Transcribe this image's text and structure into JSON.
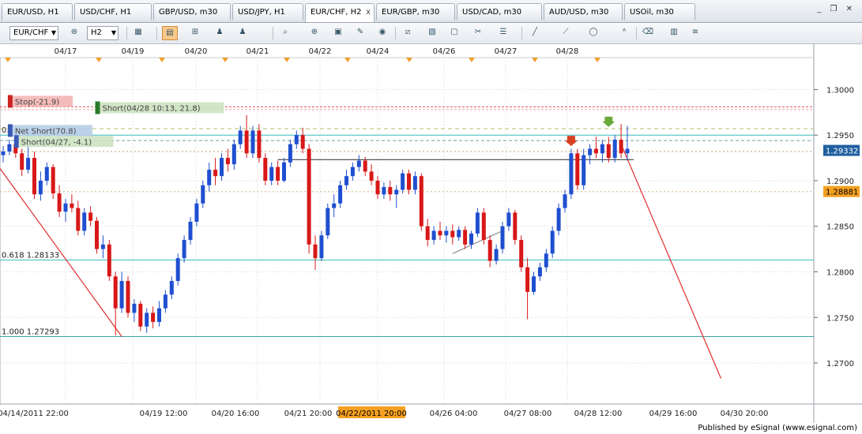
{
  "tabs": [
    {
      "label": "EUR/USD, H1"
    },
    {
      "label": "USD/CHF, H1"
    },
    {
      "label": "GBP/USD, m30"
    },
    {
      "label": "USD/JPY, H1"
    },
    {
      "label": "EUR/CHF, H2",
      "active": true,
      "close": "x"
    },
    {
      "label": "EUR/GBP, m30"
    },
    {
      "label": "USD/CAD, m30"
    },
    {
      "label": "AUD/USD, m30"
    },
    {
      "label": "USOil, m30"
    }
  ],
  "window_controls": "_ ❐ ✕",
  "toolbar": {
    "symbol": "EUR/CHF",
    "interval": "H2",
    "buttons": [
      {
        "icon": "binoculars-icon"
      },
      {
        "icon": "chart-type-icon"
      },
      {
        "icon": "bar-chart-icon",
        "active": true
      },
      {
        "icon": "tick-chart-icon"
      },
      {
        "icon": "people-icon"
      },
      {
        "icon": "people-icon"
      },
      {
        "icon": "zoom-icon"
      },
      {
        "icon": "zoom-in-icon"
      },
      {
        "icon": "chart-book-icon"
      },
      {
        "icon": "study-icon"
      },
      {
        "icon": "globe-icon"
      },
      {
        "icon": "ruler-icon"
      },
      {
        "icon": "image-icon"
      },
      {
        "icon": "window-icon"
      },
      {
        "icon": "tool-icon"
      },
      {
        "icon": "layout-icon"
      },
      {
        "icon": "pen-icon"
      },
      {
        "icon": "trendline-icon"
      },
      {
        "icon": "ellipse-icon"
      },
      {
        "icon": "text-icon"
      },
      {
        "icon": "eraser-icon"
      },
      {
        "icon": "bars-icon"
      },
      {
        "icon": "more-icon"
      }
    ]
  },
  "chart_data": {
    "type": "candlestick",
    "symbol": "EUR/CHF",
    "interval": "H2",
    "ylim": [
      1.2655,
      1.3035
    ],
    "yticks": [
      1.27,
      1.275,
      1.28,
      1.285,
      1.29,
      1.295,
      1.3
    ],
    "ytick_labels": [
      "1.2700",
      "1.2750",
      "1.2800",
      "1.2850",
      "1.2900",
      "1.2950",
      "1.3000"
    ],
    "top_dates": [
      "04/17",
      "04/19",
      "04/20",
      "04/21",
      "04/22",
      "04/24",
      "04/26",
      "04/27",
      "04/28"
    ],
    "bottom_dates": [
      "04/14/2011 22:00",
      "04/19 12:00",
      "04/20 16:00",
      "04/21 20:00",
      "04/22/2011 20:00",
      "04/26 04:00",
      "04/27 08:00",
      "04/28 12:00",
      "04/29 16:00",
      "04/30 20:00"
    ],
    "highlight_date": "04/22/2011 20:00",
    "last_price": "1.29332",
    "last_price_value": 1.29332,
    "other_price": "1.28881",
    "other_price_value": 1.28881,
    "candles": [
      [
        1.2928,
        1.2938,
        1.292,
        1.2932
      ],
      [
        1.2932,
        1.2945,
        1.2928,
        1.294
      ],
      [
        1.294,
        1.295,
        1.2925,
        1.293
      ],
      [
        1.293,
        1.2935,
        1.2905,
        1.2912
      ],
      [
        1.2912,
        1.294,
        1.2908,
        1.2925
      ],
      [
        1.2925,
        1.2932,
        1.288,
        1.2885
      ],
      [
        1.2885,
        1.291,
        1.2878,
        1.29
      ],
      [
        1.29,
        1.292,
        1.2895,
        1.2915
      ],
      [
        1.2915,
        1.2918,
        1.288,
        1.2886
      ],
      [
        1.2886,
        1.2895,
        1.286,
        1.2866
      ],
      [
        1.2866,
        1.288,
        1.2855,
        1.2875
      ],
      [
        1.2875,
        1.2885,
        1.2865,
        1.287
      ],
      [
        1.287,
        1.2878,
        1.284,
        1.2845
      ],
      [
        1.2845,
        1.287,
        1.284,
        1.2865
      ],
      [
        1.2865,
        1.2872,
        1.285,
        1.2856
      ],
      [
        1.2856,
        1.286,
        1.282,
        1.2825
      ],
      [
        1.2825,
        1.284,
        1.2815,
        1.283
      ],
      [
        1.283,
        1.2835,
        1.279,
        1.2795
      ],
      [
        1.2795,
        1.28,
        1.273,
        1.276
      ],
      [
        1.276,
        1.28,
        1.2755,
        1.279
      ],
      [
        1.279,
        1.2795,
        1.275,
        1.2755
      ],
      [
        1.2755,
        1.277,
        1.2745,
        1.2765
      ],
      [
        1.2765,
        1.2768,
        1.2735,
        1.274
      ],
      [
        1.274,
        1.276,
        1.2733,
        1.2755
      ],
      [
        1.2755,
        1.2762,
        1.2738,
        1.2745
      ],
      [
        1.2745,
        1.2768,
        1.274,
        1.276
      ],
      [
        1.276,
        1.278,
        1.2755,
        1.2775
      ],
      [
        1.2775,
        1.2795,
        1.277,
        1.279
      ],
      [
        1.279,
        1.282,
        1.2785,
        1.2815
      ],
      [
        1.2815,
        1.284,
        1.281,
        1.2835
      ],
      [
        1.2835,
        1.286,
        1.283,
        1.2855
      ],
      [
        1.2855,
        1.288,
        1.285,
        1.2875
      ],
      [
        1.2875,
        1.29,
        1.287,
        1.2895
      ],
      [
        1.2895,
        1.292,
        1.2888,
        1.2912
      ],
      [
        1.2912,
        1.2925,
        1.2895,
        1.2905
      ],
      [
        1.2905,
        1.293,
        1.29,
        1.2925
      ],
      [
        1.2925,
        1.2935,
        1.291,
        1.2918
      ],
      [
        1.2918,
        1.2945,
        1.2912,
        1.294
      ],
      [
        1.294,
        1.296,
        1.2935,
        1.2955
      ],
      [
        1.2955,
        1.2972,
        1.2925,
        1.293
      ],
      [
        1.293,
        1.296,
        1.2925,
        1.2955
      ],
      [
        1.2955,
        1.2962,
        1.292,
        1.2925
      ],
      [
        1.2925,
        1.293,
        1.2895,
        1.29
      ],
      [
        1.29,
        1.292,
        1.2895,
        1.2915
      ],
      [
        1.2915,
        1.2922,
        1.2895,
        1.29
      ],
      [
        1.29,
        1.2925,
        1.2898,
        1.292
      ],
      [
        1.292,
        1.2945,
        1.2915,
        1.294
      ],
      [
        1.294,
        1.2955,
        1.2935,
        1.295
      ],
      [
        1.295,
        1.2958,
        1.293,
        1.2935
      ],
      [
        1.2935,
        1.294,
        1.282,
        1.283
      ],
      [
        1.283,
        1.284,
        1.2802,
        1.2815
      ],
      [
        1.2815,
        1.2845,
        1.2812,
        1.284
      ],
      [
        1.284,
        1.2875,
        1.2836,
        1.287
      ],
      [
        1.287,
        1.2885,
        1.286,
        1.2875
      ],
      [
        1.2875,
        1.29,
        1.287,
        1.2895
      ],
      [
        1.2895,
        1.2912,
        1.289,
        1.2905
      ],
      [
        1.2905,
        1.292,
        1.29,
        1.2915
      ],
      [
        1.2915,
        1.2928,
        1.291,
        1.2922
      ],
      [
        1.2922,
        1.2926,
        1.2905,
        1.291
      ],
      [
        1.291,
        1.2918,
        1.2895,
        1.29
      ],
      [
        1.29,
        1.2905,
        1.288,
        1.2885
      ],
      [
        1.2885,
        1.2898,
        1.288,
        1.2893
      ],
      [
        1.2893,
        1.29,
        1.2878,
        1.2885
      ],
      [
        1.2885,
        1.2895,
        1.287,
        1.289
      ],
      [
        1.289,
        1.2912,
        1.2886,
        1.2908
      ],
      [
        1.2908,
        1.2912,
        1.2885,
        1.289
      ],
      [
        1.289,
        1.291,
        1.2885,
        1.2905
      ],
      [
        1.2905,
        1.2908,
        1.2845,
        1.285
      ],
      [
        1.285,
        1.2858,
        1.2828,
        1.2835
      ],
      [
        1.2835,
        1.285,
        1.283,
        1.2845
      ],
      [
        1.2845,
        1.2855,
        1.2835,
        1.284
      ],
      [
        1.284,
        1.285,
        1.2832,
        1.2845
      ],
      [
        1.2845,
        1.2852,
        1.283,
        1.2838
      ],
      [
        1.2838,
        1.285,
        1.2834,
        1.2846
      ],
      [
        1.2846,
        1.285,
        1.2825,
        1.283
      ],
      [
        1.283,
        1.2845,
        1.2825,
        1.2842
      ],
      [
        1.2842,
        1.287,
        1.2838,
        1.2865
      ],
      [
        1.2865,
        1.287,
        1.283,
        1.2835
      ],
      [
        1.2835,
        1.284,
        1.2805,
        1.2812
      ],
      [
        1.2812,
        1.283,
        1.2808,
        1.2825
      ],
      [
        1.2825,
        1.2855,
        1.282,
        1.285
      ],
      [
        1.285,
        1.287,
        1.2845,
        1.2865
      ],
      [
        1.2865,
        1.2868,
        1.283,
        1.2835
      ],
      [
        1.2835,
        1.284,
        1.28,
        1.2805
      ],
      [
        1.2805,
        1.2815,
        1.2748,
        1.2778
      ],
      [
        1.2778,
        1.28,
        1.2775,
        1.2795
      ],
      [
        1.2795,
        1.281,
        1.279,
        1.2805
      ],
      [
        1.2805,
        1.2825,
        1.28,
        1.282
      ],
      [
        1.282,
        1.285,
        1.2815,
        1.2845
      ],
      [
        1.2845,
        1.2875,
        1.284,
        1.287
      ],
      [
        1.287,
        1.289,
        1.2865,
        1.2885
      ],
      [
        1.2885,
        1.2935,
        1.288,
        1.293
      ],
      [
        1.293,
        1.2935,
        1.289,
        1.2895
      ],
      [
        1.2895,
        1.2935,
        1.289,
        1.2928
      ],
      [
        1.2928,
        1.294,
        1.2918,
        1.2935
      ],
      [
        1.2935,
        1.2948,
        1.2925,
        1.293
      ],
      [
        1.293,
        1.2945,
        1.292,
        1.294
      ],
      [
        1.294,
        1.2948,
        1.292,
        1.2925
      ],
      [
        1.2925,
        1.295,
        1.292,
        1.2945
      ],
      [
        1.2945,
        1.2962,
        1.2925,
        1.293
      ],
      [
        1.293,
        1.296,
        1.2922,
        1.2935
      ]
    ],
    "hlines": [
      {
        "y": 1.2813,
        "color": "#3cbcbc",
        "label": "0.618 1.28133"
      },
      {
        "y": 1.2729,
        "color": "#3aa3a3",
        "label": "1.000 1.27293"
      },
      {
        "y": 1.295,
        "color": "#3cbcbc",
        "label": "0."
      },
      {
        "y": 1.2981,
        "color": "#e05050",
        "dash": "3,2"
      },
      {
        "y": 1.2978,
        "color": "#f0a0a0",
        "dash": "3,2"
      },
      {
        "y": 1.2957,
        "color": "#b0c070",
        "dash": "5,4"
      },
      {
        "y": 1.2944,
        "color": "#70a0a0",
        "dash": "4,3"
      },
      {
        "y": 1.2932,
        "color": "#c0a070",
        "dash": "2,3"
      },
      {
        "y": 1.2888,
        "color": "#d0b080",
        "dash": "2,3"
      }
    ],
    "position_labels": [
      {
        "text": "Stop(-21.9)",
        "color": "#f4b5b5",
        "marker": "#cc2222",
        "y": 1.2987,
        "xi": 1
      },
      {
        "text": "Short(04/28 10:13, 21.8)",
        "color": "#cde3c2",
        "marker": "#2a7a2a",
        "y": 1.298,
        "xi": 15
      },
      {
        "text": "Net Short(70.8)",
        "color": "#b6cde8",
        "marker": "#3a5ab8",
        "y": 1.2955,
        "xi": 1
      },
      {
        "text": "Short(04/27, -4.1)",
        "color": "#cde3c2",
        "marker": "#3a5ab8",
        "y": 1.2943,
        "xi": 2
      }
    ],
    "arrows": [
      {
        "idx": 97,
        "y": 1.2965,
        "dir": "down",
        "color": "#6aaa3a"
      },
      {
        "idx": 91,
        "y": 1.2944,
        "dir": "down",
        "color": "#d84020"
      }
    ],
    "trend_lines": [
      {
        "from": [
          -1,
          1.2918
        ],
        "to": [
          19,
          1.2729
        ],
        "color": "#e03030"
      },
      {
        "from": [
          72,
          1.282
        ],
        "to": [
          80,
          1.2845
        ],
        "color": "#888"
      },
      {
        "from": [
          99,
          1.294
        ],
        "to": [
          115,
          1.2683
        ],
        "color": "#e03030"
      },
      {
        "from": [
          44,
          1.2923
        ],
        "to": [
          101,
          1.2923
        ],
        "color": "#555"
      }
    ]
  },
  "footer": "Published by eSignal (www.esignal.com)"
}
